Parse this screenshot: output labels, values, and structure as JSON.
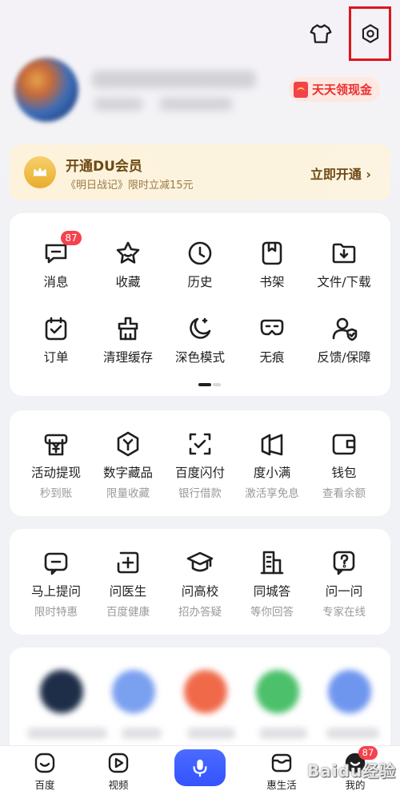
{
  "header": {
    "shirt_icon": "tshirt-icon",
    "settings_icon": "settings-icon",
    "highlight_color": "#e0141c"
  },
  "profile": {
    "cash_label": "天天领现金"
  },
  "vip": {
    "title": "开通DU会员",
    "subtitle": "《明日战记》限时立减15元",
    "cta": "立即开通 ›"
  },
  "grid_primary": {
    "row1": [
      {
        "label": "消息",
        "icon": "message-icon",
        "badge": "87"
      },
      {
        "label": "收藏",
        "icon": "star-icon"
      },
      {
        "label": "历史",
        "icon": "clock-icon"
      },
      {
        "label": "书架",
        "icon": "bookshelf-icon"
      },
      {
        "label": "文件/下载",
        "icon": "folder-download-icon"
      }
    ],
    "row2": [
      {
        "label": "订单",
        "icon": "order-icon"
      },
      {
        "label": "清理缓存",
        "icon": "broom-icon"
      },
      {
        "label": "深色模式",
        "icon": "moon-icon"
      },
      {
        "label": "无痕",
        "icon": "mask-icon"
      },
      {
        "label": "反馈/保障",
        "icon": "feedback-icon"
      }
    ]
  },
  "grid_finance": [
    {
      "label": "活动提现",
      "sub": "秒到账",
      "icon": "yen-icon"
    },
    {
      "label": "数字藏品",
      "sub": "限量收藏",
      "icon": "hexagon-icon"
    },
    {
      "label": "百度闪付",
      "sub": "银行借款",
      "icon": "scan-icon"
    },
    {
      "label": "度小满",
      "sub": "激活享免息",
      "icon": "duxiaoman-icon"
    },
    {
      "label": "钱包",
      "sub": "查看余额",
      "icon": "wallet-icon"
    }
  ],
  "grid_qa": [
    {
      "label": "马上提问",
      "sub": "限时特惠",
      "icon": "ask-icon"
    },
    {
      "label": "问医生",
      "sub": "百度健康",
      "icon": "medical-icon"
    },
    {
      "label": "问高校",
      "sub": "招办答疑",
      "icon": "graduation-icon"
    },
    {
      "label": "同城答",
      "sub": "等你回答",
      "icon": "building-icon"
    },
    {
      "label": "问一问",
      "sub": "专家在线",
      "icon": "question-icon"
    }
  ],
  "bottom_nav": [
    {
      "label": "百度",
      "icon": "baidu-home-icon"
    },
    {
      "label": "视频",
      "icon": "video-icon"
    },
    {
      "label": "",
      "icon": "microphone-icon"
    },
    {
      "label": "惠生活",
      "icon": "shop-icon"
    },
    {
      "label": "我的",
      "icon": "profile-icon",
      "badge": "87"
    }
  ],
  "watermark": "Baidu经验",
  "colors": {
    "accent_blue": "#3453ff",
    "badge_red": "#f5424d",
    "vip_text": "#6d4a14"
  }
}
